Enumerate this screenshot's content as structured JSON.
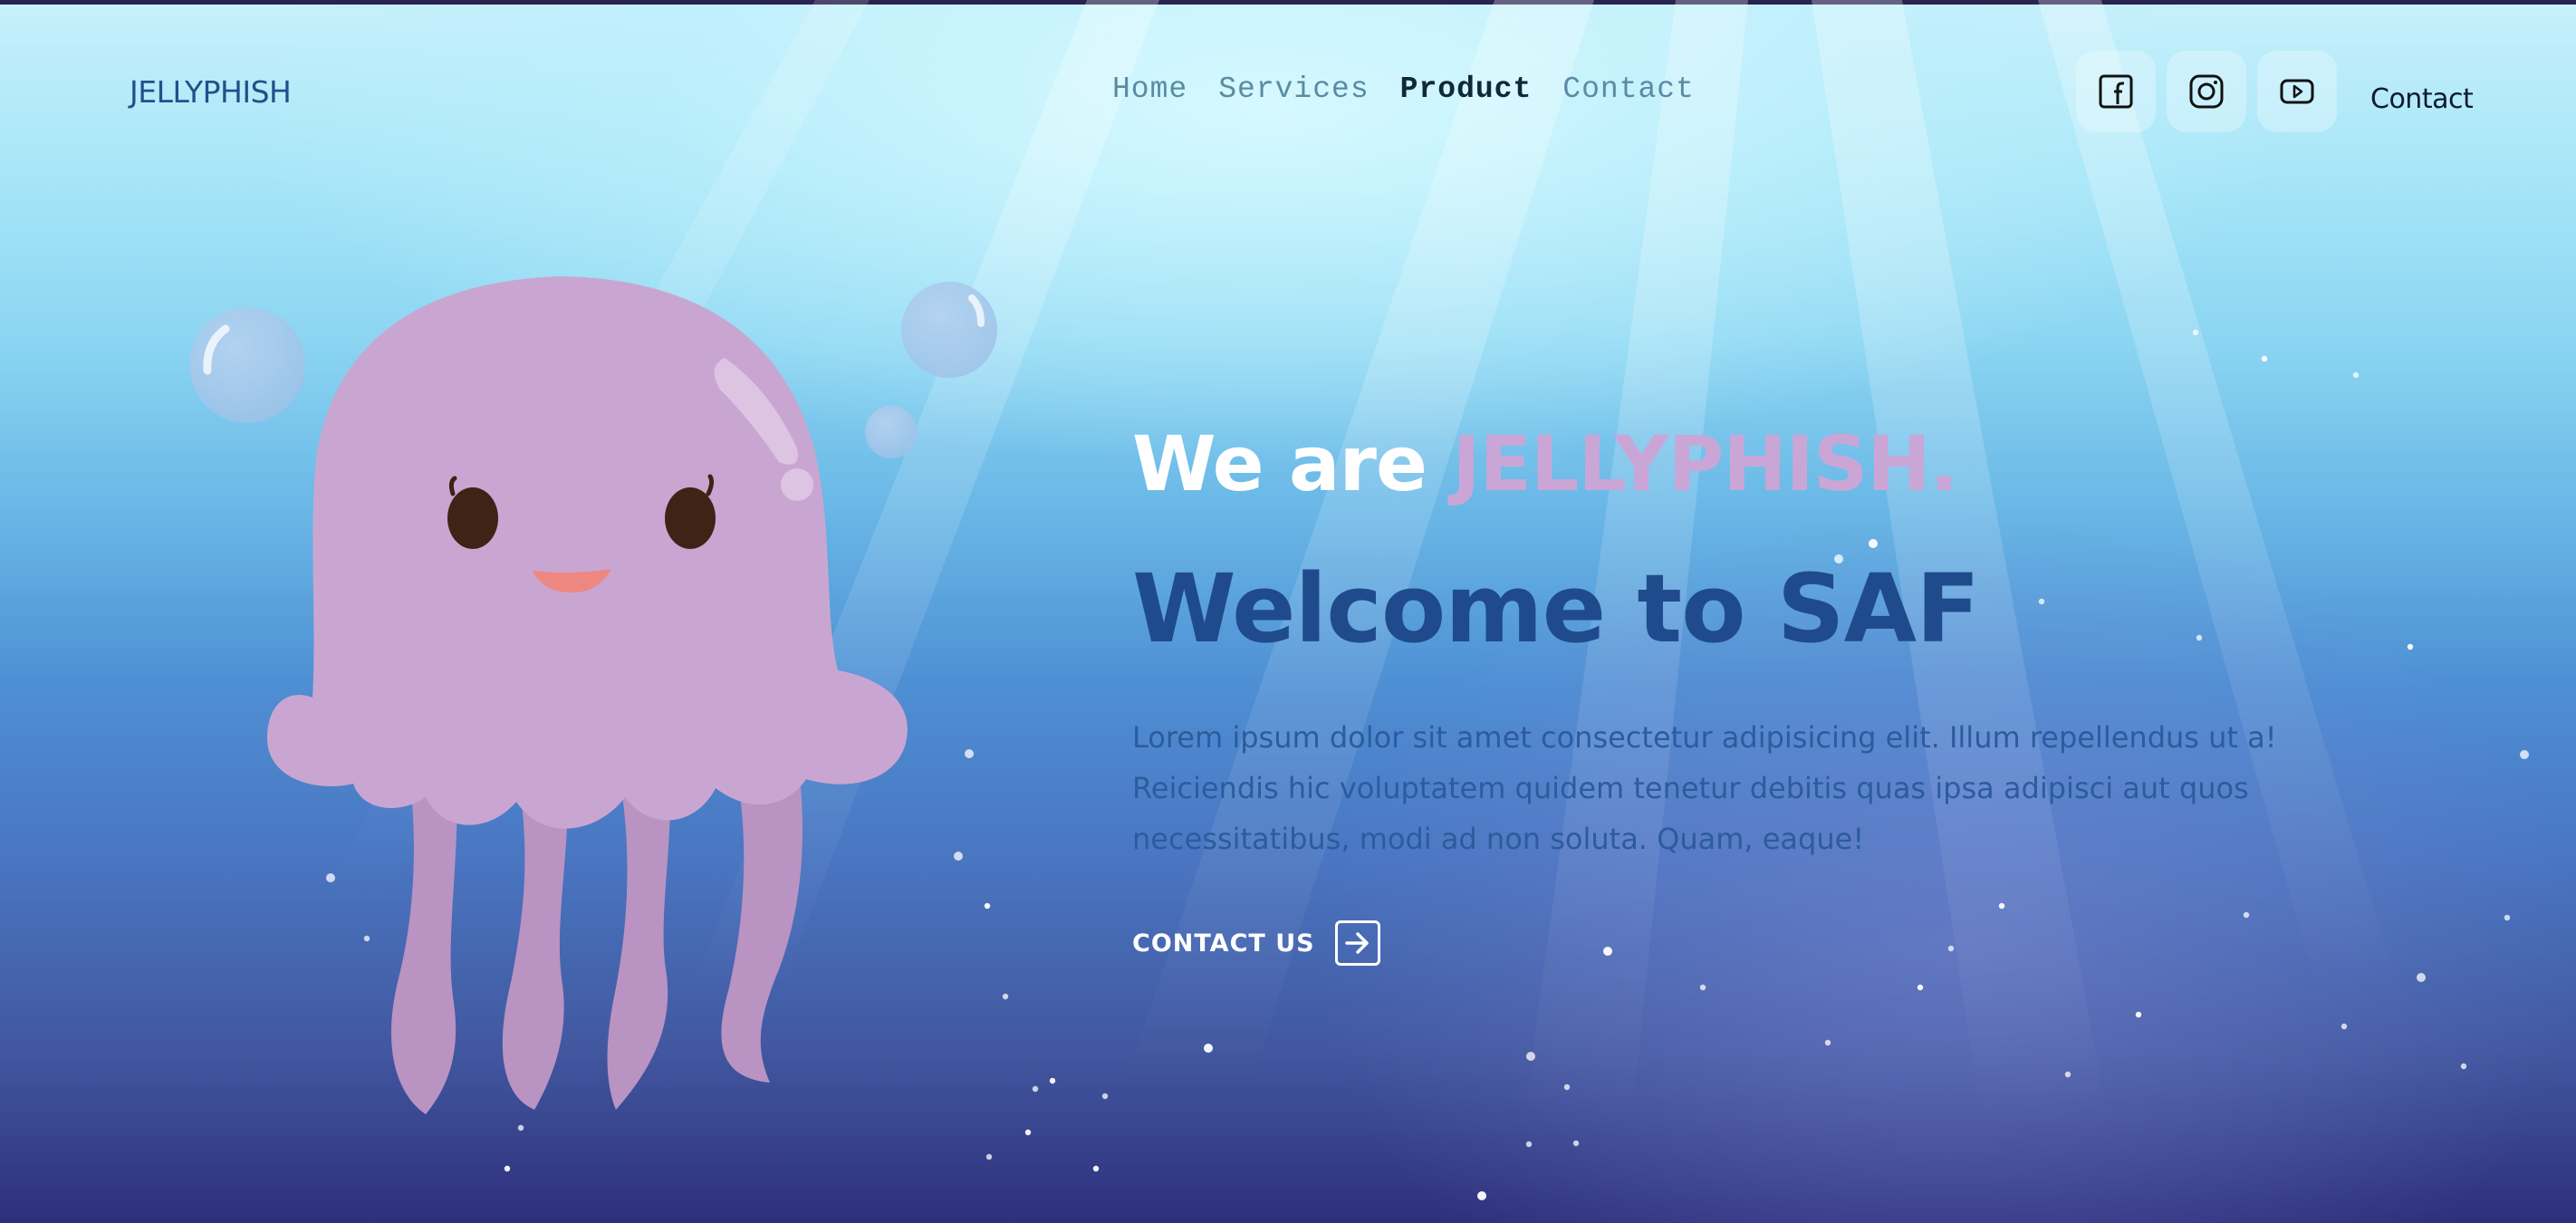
{
  "brand": "JELLYPHISH",
  "nav": [
    {
      "label": "Home",
      "active": false
    },
    {
      "label": "Services",
      "active": false
    },
    {
      "label": "Product",
      "active": true
    },
    {
      "label": "Contact",
      "active": false
    }
  ],
  "social_icons": [
    "facebook-icon",
    "instagram-icon",
    "youtube-icon"
  ],
  "header_contact": "Contact",
  "hero": {
    "tagline_prefix": "We are ",
    "tagline_highlight": "JELLYPHISH.",
    "title": "Welcome to SAF",
    "description": "Lorem ipsum dolor sit amet consectetur adipisicing elit. Illum repellendus ut a! Reiciendis hic voluptatem quidem tenetur debitis quas ipsa adipisci aut quos necessitatibus, modi ad non soluta. Quam, eaque!",
    "cta_label": "CONTACT US",
    "cta_icon": "arrow-right-icon"
  },
  "colors": {
    "brand_text": "#22508a",
    "highlight": "#c9a6d6",
    "title": "#1f4b8c",
    "jellyfish": "#c9a6d1"
  }
}
